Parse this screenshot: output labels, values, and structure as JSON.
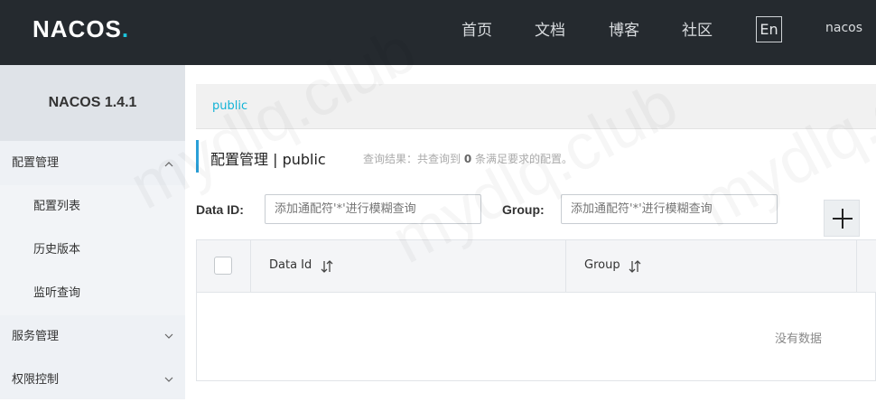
{
  "header": {
    "logo_main": "NACOS",
    "logo_dot": ".",
    "nav": [
      "首页",
      "文档",
      "博客",
      "社区"
    ],
    "lang": "En",
    "user": "nacos"
  },
  "sidebar": {
    "version": "NACOS 1.4.1",
    "items": [
      {
        "label": "配置管理",
        "type": "group",
        "expanded": true
      },
      {
        "label": "配置列表",
        "type": "sub"
      },
      {
        "label": "历史版本",
        "type": "sub"
      },
      {
        "label": "监听查询",
        "type": "sub"
      },
      {
        "label": "服务管理",
        "type": "group",
        "expanded": false
      },
      {
        "label": "权限控制",
        "type": "group",
        "expanded": false
      }
    ]
  },
  "main": {
    "namespace": "public",
    "title": "配置管理 | public",
    "result_prefix": "查询结果：共查询到",
    "result_count": "0",
    "result_suffix": "条满足要求的配置。",
    "filters": {
      "dataid_label": "Data ID:",
      "dataid_placeholder": "添加通配符'*'进行模糊查询",
      "group_label": "Group:",
      "group_placeholder": "添加通配符'*'进行模糊查询"
    },
    "table": {
      "columns": [
        "Data Id",
        "Group"
      ],
      "empty_text": "没有数据"
    }
  },
  "watermark": "mydlq.club",
  "colors": {
    "topbar": "#252a2f",
    "accent": "#1bc5dc",
    "namespace": "#12b3d6",
    "sidebar": "#eef1f5"
  }
}
